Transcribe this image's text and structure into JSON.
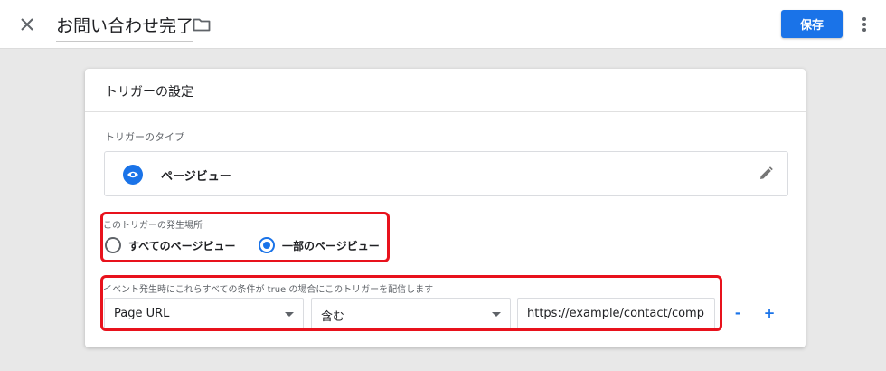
{
  "header": {
    "title": "お問い合わせ完了",
    "save_label": "保存",
    "icons": {
      "close": "close-icon",
      "folder": "folder-icon",
      "more": "more-vert-icon"
    }
  },
  "card": {
    "title": "トリガーの設定",
    "trigger_type": {
      "label": "トリガーのタイプ",
      "name": "ページビュー",
      "icon": "eye-icon",
      "edit_icon": "pencil-icon"
    },
    "fire_on": {
      "label": "このトリガーの発生場所",
      "options": [
        {
          "label": "すべてのページビュー",
          "selected": false
        },
        {
          "label": "一部のページビュー",
          "selected": true
        }
      ]
    },
    "condition": {
      "label": "イベント発生時にこれらすべての条件が true の場合にこのトリガーを配信します",
      "variable": "Page URL",
      "operator": "含む",
      "value": "https://example/contact/complete",
      "remove_label": "-",
      "add_label": "+"
    }
  },
  "colors": {
    "accent": "#1a73e8",
    "highlight": "#e8121c",
    "background": "#e8e8e8"
  }
}
